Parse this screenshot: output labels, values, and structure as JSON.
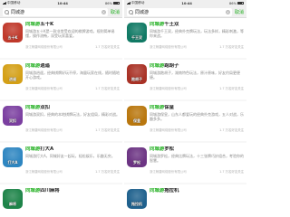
{
  "status": {
    "carrier": "中国移动",
    "time": "10:44",
    "battery": "86%"
  },
  "search": {
    "query": "同城游",
    "cancel": "取消",
    "clear_glyph": "×"
  },
  "cards_left": [
    {
      "title_prefix": "同城游",
      "title_suffix": "五十K",
      "desc": "同城游五十K是一款非常受欢迎的棋牌游戏，规则简单易懂，操作流畅，深受玩家喜爱。",
      "org": "浙江畅唐网络股份有限公司",
      "fans": "1.7 万名好友关注",
      "color": "#c0392b",
      "avatar_text": "五十K"
    },
    {
      "title_prefix": "同城游",
      "title_suffix": "逍遥",
      "desc": "同城游逍遥，经典棋牌好玩不停，海量玩家在线，随时随地开心游戏。",
      "org": "浙江畅唐网络股份有限公司",
      "fans": "1.7 万名好友关注",
      "color": "#d4a017",
      "avatar_text": "逍遥"
    },
    {
      "title_prefix": "同城游",
      "title_suffix": "双扣",
      "desc": "同城游双扣，经典的本地棋牌玩法，好友组局，精彩对战。",
      "org": "浙江畅唐网络股份有限公司",
      "fans": "1.7 万名好友关注",
      "color": "#7b3fa0",
      "avatar_text": "双扣"
    },
    {
      "title_prefix": "同城游",
      "title_suffix": "打大A",
      "desc": "同城游打大A，同城好友一起玩，轻松娱乐，乐趣无穷。",
      "org": "浙江畅唐网络股份有限公司",
      "fans": "1.7 万名好友关注",
      "color": "#2e86c1",
      "avatar_text": "打大A"
    },
    {
      "title_prefix": "同城游",
      "title_suffix": "四川麻将",
      "desc": "",
      "org": "",
      "fans": "",
      "color": "#1e8449",
      "avatar_text": "麻将"
    }
  ],
  "cards_right": [
    {
      "title_prefix": "同城游",
      "title_suffix": "千王双",
      "desc": "同城游千王双，经典扑克牌玩法，玩法多样，精彩刺激，等你来战。",
      "org": "浙江畅唐网络股份有限公司",
      "fans": "1.7 万名好友关注",
      "color": "#117a65",
      "avatar_text": "千王双"
    },
    {
      "title_prefix": "同城游",
      "title_suffix": "跑胡子",
      "desc": "同城游跑胡子，湖南特色玩法，原汁原味，好友约局更便捷。",
      "org": "浙江畅唐网络股份有限公司",
      "fans": "1.7 万名好友关注",
      "color": "#a93226",
      "avatar_text": "跑胡子"
    },
    {
      "title_prefix": "同城游",
      "title_suffix": "保皇",
      "desc": "同城游保皇，山东人都爱玩的经典扑克游戏，五人对战，乐趣多多。",
      "org": "浙江畅唐网络股份有限公司",
      "fans": "1.7 万名好友关注",
      "color": "#b9770e",
      "avatar_text": "保皇"
    },
    {
      "title_prefix": "同城游",
      "title_suffix": "罗松",
      "desc": "同城游罗松，经典比牌玩法，十三张牌巧妙组合，考验你的智慧。",
      "org": "浙江畅唐网络股份有限公司",
      "fans": "1.7 万名好友关注",
      "color": "#6c3483",
      "avatar_text": "罗松"
    },
    {
      "title_prefix": "同城游",
      "title_suffix": "拖拉机",
      "desc": "",
      "org": "",
      "fans": "",
      "color": "#1f618d",
      "avatar_text": "拖拉机"
    }
  ]
}
